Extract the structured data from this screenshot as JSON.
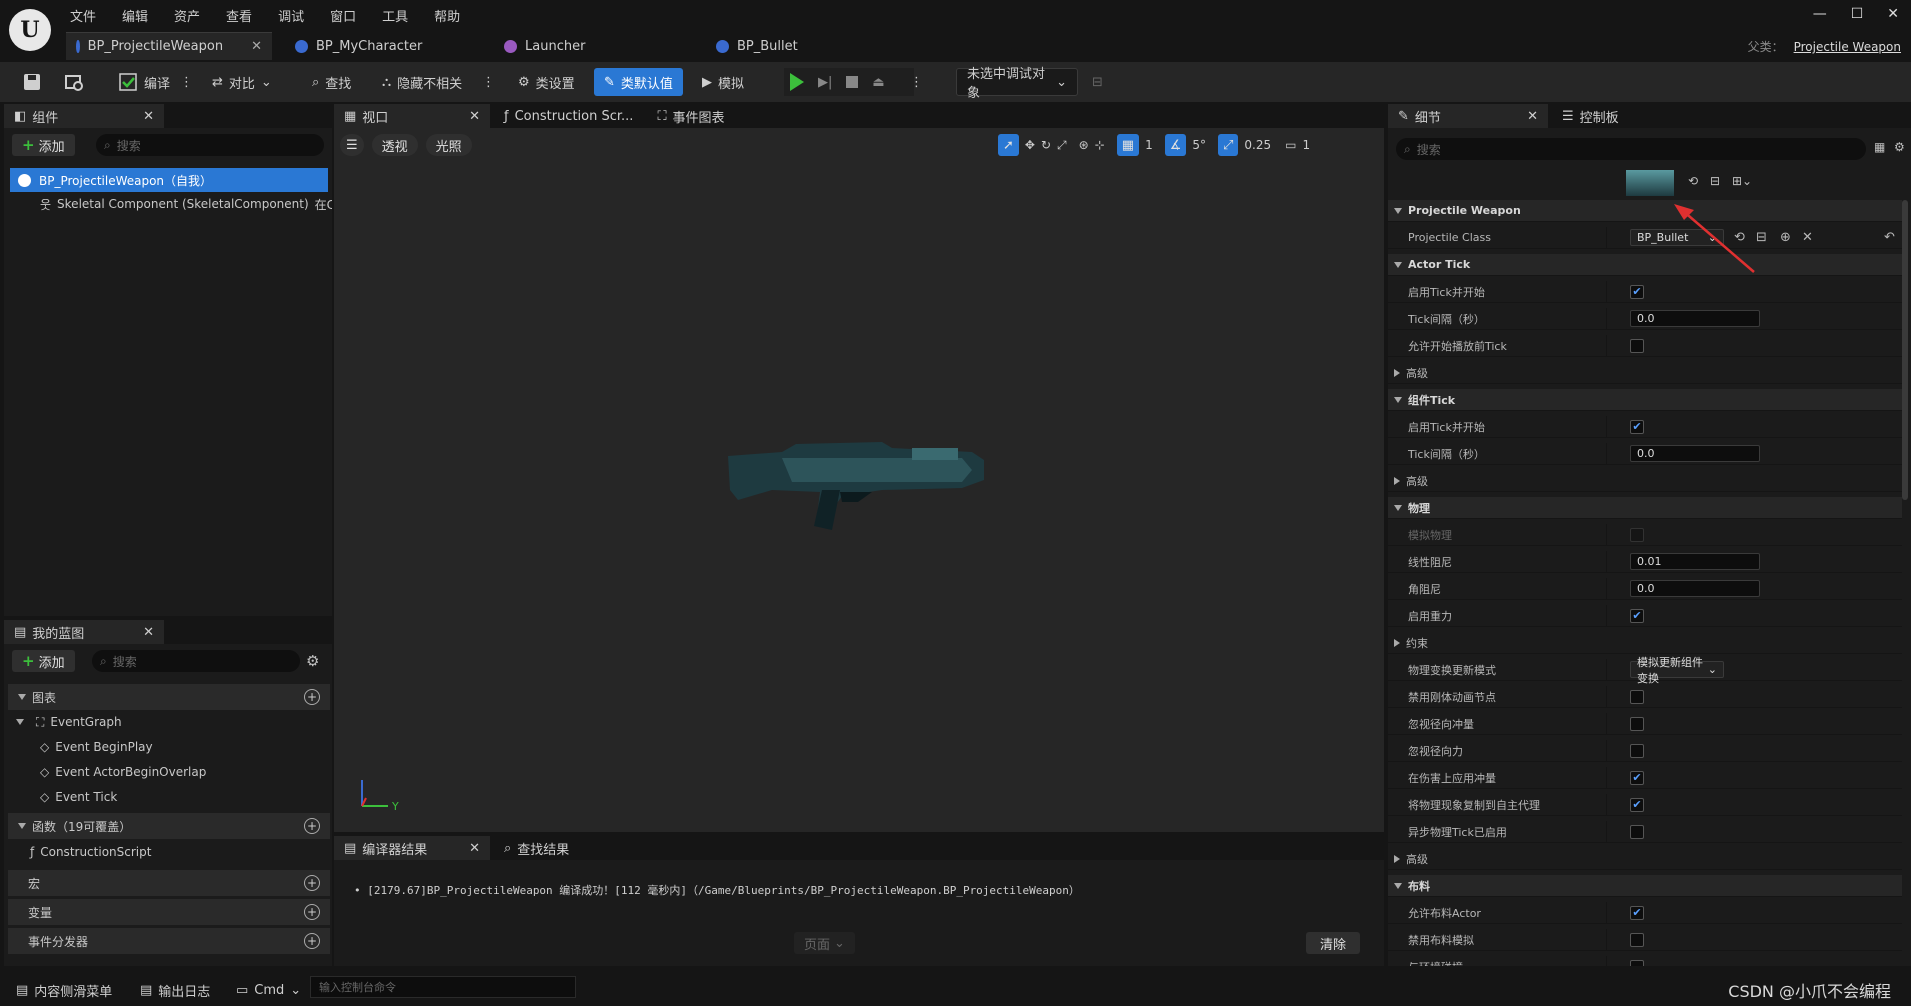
{
  "menu": [
    "文件",
    "编辑",
    "资产",
    "查看",
    "调试",
    "窗口",
    "工具",
    "帮助"
  ],
  "tabs": [
    {
      "label": "BP_ProjectileWeapon",
      "active": true
    },
    {
      "label": "BP_MyCharacter"
    },
    {
      "label": "Launcher"
    },
    {
      "label": "BP_Bullet"
    }
  ],
  "parent": {
    "label": "父类：",
    "value": "Projectile Weapon"
  },
  "toolbar": {
    "compile": "编译",
    "diff": "对比",
    "find": "查找",
    "hide_unrelated": "隐藏不相关",
    "class_settings": "类设置",
    "class_defaults": "类默认值",
    "simulate": "模拟",
    "debug_target": "未选中调试对象"
  },
  "components": {
    "title": "组件",
    "add": "添加",
    "search_placeholder": "搜索",
    "root": "BP_ProjectileWeapon（自我）",
    "child": "Skeletal Component (SkeletalComponent)",
    "child_suffix": "在C"
  },
  "blueprint": {
    "title": "我的蓝图",
    "add": "添加",
    "search_placeholder": "搜索",
    "graphs_label": "图表",
    "event_graph": "EventGraph",
    "events": [
      "Event BeginPlay",
      "Event ActorBeginOverlap",
      "Event Tick"
    ],
    "functions_label": "函数（19可覆盖）",
    "construction_script": "ConstructionScript",
    "macros_label": "宏",
    "variables_label": "变量",
    "dispatchers_label": "事件分发器"
  },
  "viewport": {
    "tabs": [
      "视口",
      "Construction Scr...",
      "事件图表"
    ],
    "perspective": "透视",
    "lighting": "光照",
    "grid_value": "1",
    "angle_value": "5°",
    "scale_value": "0.25",
    "camera_value": "1",
    "axis_y": "Y"
  },
  "compiler": {
    "tab": "编译器结果",
    "find_tab": "查找结果",
    "message": "[2179.67]BP_ProjectileWeapon 编译成功！[112 毫秒内]（/Game/Blueprints/BP_ProjectileWeapon.BP_ProjectileWeapon）",
    "page": "页面",
    "clear": "清除"
  },
  "details": {
    "tab": "细节",
    "palette_tab": "控制板",
    "search_placeholder": "搜索",
    "rows": [
      {
        "type": "section",
        "label": "Projectile Weapon"
      },
      {
        "type": "dropdown",
        "label": "Projectile Class",
        "value": "BP_Bullet"
      },
      {
        "type": "section",
        "label": "Actor Tick"
      },
      {
        "type": "check",
        "label": "启用Tick并开始",
        "checked": true
      },
      {
        "type": "field",
        "label": "Tick间隔（秒）",
        "value": "0.0"
      },
      {
        "type": "check",
        "label": "允许开始播放前Tick",
        "checked": false
      },
      {
        "type": "collapsed",
        "label": "高级"
      },
      {
        "type": "section",
        "label": "组件Tick"
      },
      {
        "type": "check",
        "label": "启用Tick并开始",
        "checked": true
      },
      {
        "type": "field",
        "label": "Tick间隔（秒）",
        "value": "0.0"
      },
      {
        "type": "collapsed",
        "label": "高级"
      },
      {
        "type": "section",
        "label": "物理"
      },
      {
        "type": "check",
        "label": "模拟物理",
        "checked": false,
        "disabled": true
      },
      {
        "type": "field",
        "label": "线性阻尼",
        "value": "0.01"
      },
      {
        "type": "field",
        "label": "角阻尼",
        "value": "0.0"
      },
      {
        "type": "check",
        "label": "启用重力",
        "checked": true
      },
      {
        "type": "collapsed",
        "label": "约束"
      },
      {
        "type": "dropdown",
        "label": "物理变换更新模式",
        "value": "模拟更新组件变换"
      },
      {
        "type": "check",
        "label": "禁用刚体动画节点",
        "checked": false
      },
      {
        "type": "check",
        "label": "忽视径向冲量",
        "checked": false
      },
      {
        "type": "check",
        "label": "忽视径向力",
        "checked": false
      },
      {
        "type": "check",
        "label": "在伤害上应用冲量",
        "checked": true
      },
      {
        "type": "check",
        "label": "将物理现象复制到自主代理",
        "checked": true
      },
      {
        "type": "check",
        "label": "异步物理Tick已启用",
        "checked": false
      },
      {
        "type": "collapsed",
        "label": "高级"
      },
      {
        "type": "section",
        "label": "布料"
      },
      {
        "type": "check",
        "label": "允许布料Actor",
        "checked": true
      },
      {
        "type": "check",
        "label": "禁用布料模拟",
        "checked": false
      },
      {
        "type": "check",
        "label": "与环境碰撞",
        "checked": false
      }
    ]
  },
  "statusbar": {
    "content_drawer": "内容侧滑菜单",
    "output_log": "输出日志",
    "cmd": "Cmd",
    "console_placeholder": "输入控制台命令",
    "watermark": "CSDN @小爪不会编程"
  },
  "colors": {
    "accent": "#2a78d4",
    "play": "#3cbf3c",
    "arrow": "#e03030"
  }
}
